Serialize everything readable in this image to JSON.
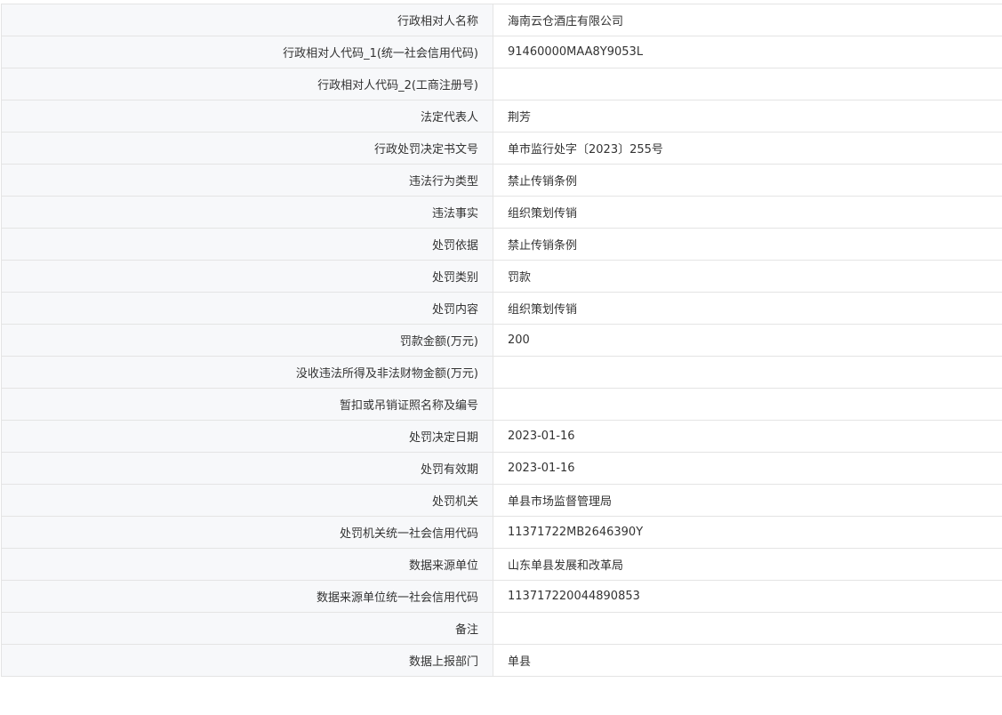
{
  "rows": [
    {
      "label": "行政相对人名称",
      "value": "海南云仓酒庄有限公司"
    },
    {
      "label": "行政相对人代码_1(统一社会信用代码)",
      "value": "91460000MAA8Y9053L"
    },
    {
      "label": "行政相对人代码_2(工商注册号)",
      "value": ""
    },
    {
      "label": "法定代表人",
      "value": "荆芳"
    },
    {
      "label": "行政处罚决定书文号",
      "value": "单市监行处字〔2023〕255号"
    },
    {
      "label": "违法行为类型",
      "value": "禁止传销条例"
    },
    {
      "label": "违法事实",
      "value": "组织策划传销"
    },
    {
      "label": "处罚依据",
      "value": "禁止传销条例"
    },
    {
      "label": "处罚类别",
      "value": "罚款"
    },
    {
      "label": "处罚内容",
      "value": "组织策划传销"
    },
    {
      "label": "罚款金额(万元)",
      "value": "200"
    },
    {
      "label": "没收违法所得及非法财物金额(万元)",
      "value": ""
    },
    {
      "label": "暂扣或吊销证照名称及编号",
      "value": ""
    },
    {
      "label": "处罚决定日期",
      "value": "2023-01-16"
    },
    {
      "label": "处罚有效期",
      "value": "2023-01-16"
    },
    {
      "label": "处罚机关",
      "value": "单县市场监督管理局"
    },
    {
      "label": "处罚机关统一社会信用代码",
      "value": "11371722MB2646390Y"
    },
    {
      "label": "数据来源单位",
      "value": "山东单县发展和改革局"
    },
    {
      "label": "数据来源单位统一社会信用代码",
      "value": "113717220044890853"
    },
    {
      "label": "备注",
      "value": ""
    },
    {
      "label": "数据上报部门",
      "value": "单县"
    }
  ]
}
